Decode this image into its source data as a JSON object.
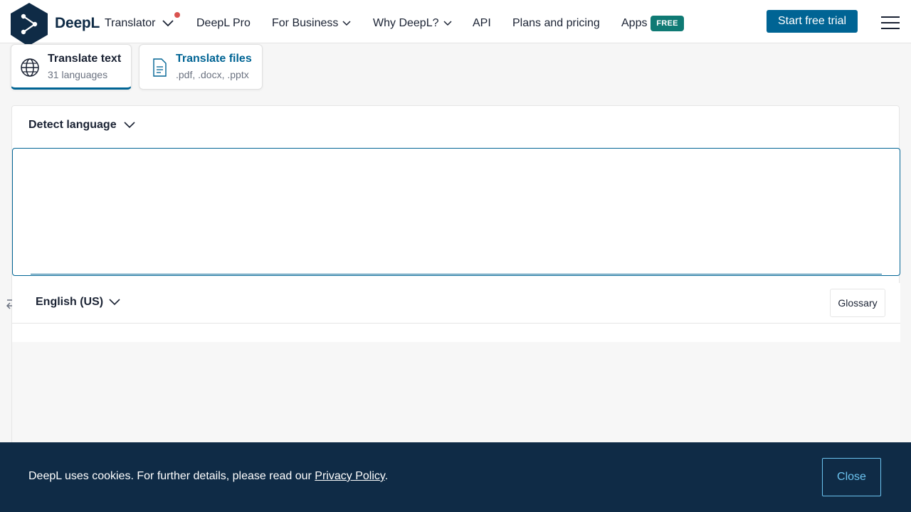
{
  "header": {
    "brand": "DeepL",
    "product": "Translator",
    "nav": {
      "pro": "DeepL Pro",
      "business": "For Business",
      "why": "Why DeepL?",
      "api": "API",
      "plans": "Plans and pricing",
      "apps": "Apps",
      "apps_badge": "FREE"
    },
    "cta": "Start free trial"
  },
  "tabs": [
    {
      "title": "Translate text",
      "subtitle": "31 languages"
    },
    {
      "title": "Translate files",
      "subtitle": ".pdf, .docx, .pptx"
    }
  ],
  "translator": {
    "source_language": "Detect language",
    "source_text": "",
    "target_language": "English (US)",
    "glossary_label": "Glossary"
  },
  "cookie": {
    "text_before": "DeepL uses cookies. For further details, please read our ",
    "link": "Privacy Policy",
    "text_after": ".",
    "close_label": "Close"
  },
  "colors": {
    "brand_navy": "#0f2b46",
    "accent_blue": "#006494",
    "badge_teal": "#0f7a74",
    "notification_red": "#d9534f",
    "close_outline": "#6cc4f0"
  }
}
